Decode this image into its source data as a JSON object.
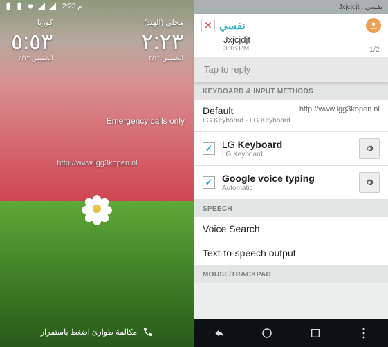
{
  "left": {
    "status": {
      "time": "2:23",
      "period": "م"
    },
    "clock1": {
      "label": "محلي (الهند)",
      "time": "٢:٢٣",
      "date": "الخميس ٣/١٣"
    },
    "clock2": {
      "label": "كوريا",
      "time": "٥:٥٣",
      "date": "الخميس ٣/١٣"
    },
    "emergency": "Emergency calls only",
    "watermark": "http://www.lgg3kopen.nl",
    "bottom_hint": "مكالمة طوارئ اضغط باستمرار"
  },
  "right": {
    "status_text": "نفسي : Jxjcjdjt",
    "notif": {
      "ar_title": "نفسي",
      "name": "Jxjcjdjt",
      "time": "3:16 PM",
      "count": "1/2",
      "reply_placeholder": "Tap to reply"
    },
    "sections": {
      "input_hdr": "KEYBOARD & INPUT METHODS",
      "default": {
        "label": "Default",
        "url": "http://www.lgg3kopen.nl",
        "sub": "LG Keyboard - LG Keyboard"
      },
      "lg": {
        "title_pre": "LG ",
        "title_bold": "Keyboard",
        "sub": "LG Keyboard"
      },
      "google": {
        "title_bold": "Google voice typing",
        "sub": "Automatic"
      },
      "speech_hdr": "SPEECH",
      "voice_search": "Voice Search",
      "tts": "Text-to-speech output",
      "mouse_hdr": "MOUSE/TRACKPAD"
    }
  }
}
